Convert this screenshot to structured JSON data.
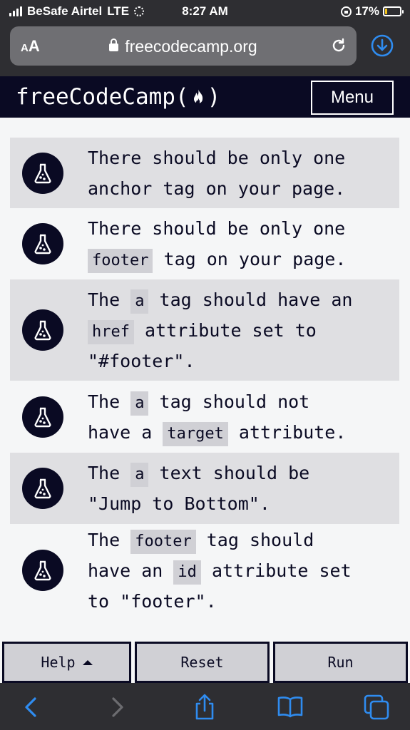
{
  "status_bar": {
    "carrier": "BeSafe Airtel",
    "network": "LTE",
    "time": "8:27 AM",
    "battery": "17%",
    "battery_level": 0.17
  },
  "browser": {
    "text_size_label": "AA",
    "url": "freecodecamp.org"
  },
  "nav": {
    "logo_left": "freeCodeCamp(",
    "logo_right": ")",
    "menu_label": "Menu"
  },
  "tests": [
    {
      "shaded": true,
      "lines": [
        [
          {
            "t": "There should be only one"
          }
        ],
        [
          {
            "t": "anchor tag on your page."
          }
        ]
      ]
    },
    {
      "shaded": false,
      "lines": [
        [
          {
            "t": "There should be only one"
          }
        ],
        [
          {
            "c": "footer"
          },
          {
            "t": " tag on your page."
          }
        ]
      ]
    },
    {
      "shaded": true,
      "lines": [
        [
          {
            "t": "The "
          },
          {
            "c": "a"
          },
          {
            "t": " tag should have an"
          }
        ],
        [
          {
            "c": "href"
          },
          {
            "t": " attribute set to"
          }
        ],
        [
          {
            "t": "\"#footer\"."
          }
        ]
      ]
    },
    {
      "shaded": false,
      "lines": [
        [
          {
            "t": "The "
          },
          {
            "c": "a"
          },
          {
            "t": " tag should not"
          }
        ],
        [
          {
            "t": "have a "
          },
          {
            "c": "target"
          },
          {
            "t": " attribute."
          }
        ]
      ]
    },
    {
      "shaded": true,
      "lines": [
        [
          {
            "t": "The "
          },
          {
            "c": "a"
          },
          {
            "t": " text should be"
          }
        ],
        [
          {
            "t": "\"Jump to Bottom\"."
          }
        ]
      ]
    },
    {
      "shaded": false,
      "lines": [
        [
          {
            "t": "The "
          },
          {
            "c": "footer"
          },
          {
            "t": " tag should"
          }
        ],
        [
          {
            "t": "have an "
          },
          {
            "c": "id"
          },
          {
            "t": " attribute set"
          }
        ],
        [
          {
            "t": "to \"footer\"."
          }
        ]
      ]
    }
  ],
  "buttons": {
    "help": "Help",
    "reset": "Reset",
    "run": "Run"
  },
  "colors": {
    "fcc_dark": "#0a0a23",
    "ios_blue": "#2f8cf0"
  }
}
